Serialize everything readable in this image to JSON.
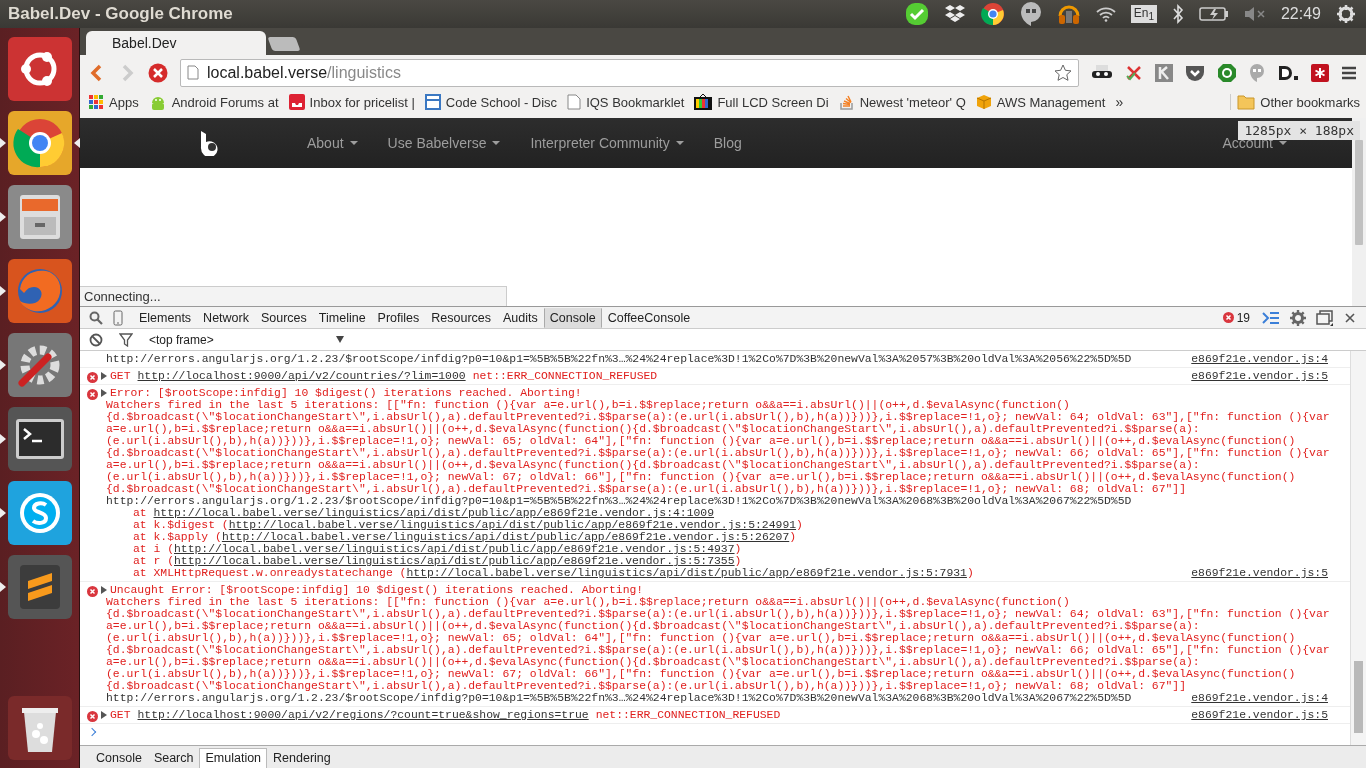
{
  "top_panel": {
    "title": "Babel.Dev - Google Chrome",
    "keyboard_layout": "En$_{1}$",
    "clock": "22:49"
  },
  "launcher": {
    "items": [
      {
        "kind": "ubuntu",
        "running": false,
        "focused": false
      },
      {
        "kind": "chrome",
        "running": true,
        "focused": true
      },
      {
        "kind": "files",
        "running": true,
        "focused": false
      },
      {
        "kind": "firefox",
        "running": true,
        "focused": false
      },
      {
        "kind": "settings",
        "running": true,
        "focused": false
      },
      {
        "kind": "terminal",
        "running": true,
        "focused": false
      },
      {
        "kind": "skype",
        "running": true,
        "focused": false
      },
      {
        "kind": "sublime",
        "running": true,
        "focused": false
      },
      {
        "kind": "trash",
        "running": false,
        "focused": false
      }
    ]
  },
  "browser": {
    "tab": {
      "title": "Babel.Dev"
    },
    "address": {
      "host": "local.babel.verse",
      "path": "/linguistics"
    },
    "bookmarks": [
      {
        "label": "Apps",
        "kind": "apps"
      },
      {
        "label": "Android Forums at",
        "kind": "robot"
      },
      {
        "label": "Inbox for pricelist |",
        "kind": "inbox"
      },
      {
        "label": "Code School - Disc",
        "kind": "window"
      },
      {
        "label": "IQS Bookmarklet",
        "kind": "page"
      },
      {
        "label": "Full LCD Screen Di",
        "kind": "tv"
      },
      {
        "label": "Newest 'meteor' Q",
        "kind": "stack"
      },
      {
        "label": "AWS Management",
        "kind": "cube"
      }
    ],
    "overflow": "»",
    "other_bookmarks": "Other bookmarks"
  },
  "page": {
    "nav": [
      {
        "label": "About",
        "caret": true
      },
      {
        "label": "Use Babelverse",
        "caret": true
      },
      {
        "label": "Interpreter Community",
        "caret": true
      },
      {
        "label": "Blog",
        "caret": false
      },
      {
        "label": "Account",
        "caret": true
      }
    ],
    "status": "Connecting...",
    "size_tooltip": "1285px × 188px"
  },
  "devtools": {
    "tabs": [
      {
        "label": "Elements",
        "selected": false
      },
      {
        "label": "Network",
        "selected": false
      },
      {
        "label": "Sources",
        "selected": false
      },
      {
        "label": "Timeline",
        "selected": false
      },
      {
        "label": "Profiles",
        "selected": false
      },
      {
        "label": "Resources",
        "selected": false
      },
      {
        "label": "Audits",
        "selected": false
      },
      {
        "label": "Console",
        "selected": true
      },
      {
        "label": "CoffeeConsole",
        "selected": false
      }
    ],
    "error_count": "19",
    "context": "<top frame>",
    "messages": [
      {
        "kind": "continuation",
        "text": "http://errors.angularjs.org/1.2.23/$rootScope/infdig?p0=10&p1=%5B%5B%22fn%3…%24%24replace%3D!1%2Co%7D%3B%20newVal%3A%2057%3B%20oldVal%3A%2056%22%5D%5D",
        "source": "e869f21e.vendor.js:4"
      },
      {
        "kind": "network",
        "method": "GET",
        "url": "http://localhost:9000/api/v2/countries/?lim=1000",
        "status": "net::ERR_CONNECTION_REFUSED",
        "source": "e869f21e.vendor.js:5"
      },
      {
        "kind": "error",
        "heading": "Error: [$rootScope:infdig] 10 $digest() iterations reached. Aborting!",
        "lines": [
          "Watchers fired in the last 5 iterations: [[\"fn: function (){var a=e.url(),b=i.$$replace;return o&&a==i.absUrl()||(o++,d.$evalAsync(function()",
          "{d.$broadcast(\\\"$locationChangeStart\\\",i.absUrl(),a).defaultPrevented?i.$$parse(a):(e.url(i.absUrl(),b),h(a))}))},i.$$replace=!1,o}; newVal: 64; oldVal: 63\"],[\"fn: function (){var",
          "a=e.url(),b=i.$$replace;return o&&a==i.absUrl()||(o++,d.$evalAsync(function(){d.$broadcast(\\\"$locationChangeStart\\\",i.absUrl(),a).defaultPrevented?i.$$parse(a):",
          "(e.url(i.absUrl(),b),h(a))}))},i.$$replace=!1,o}; newVal: 65; oldVal: 64\"],[\"fn: function (){var a=e.url(),b=i.$$replace;return o&&a==i.absUrl()||(o++,d.$evalAsync(function()",
          "{d.$broadcast(\\\"$locationChangeStart\\\",i.absUrl(),a).defaultPrevented?i.$$parse(a):(e.url(i.absUrl(),b),h(a))}))},i.$$replace=!1,o}; newVal: 66; oldVal: 65\"],[\"fn: function (){var",
          "a=e.url(),b=i.$$replace;return o&&a==i.absUrl()||(o++,d.$evalAsync(function(){d.$broadcast(\\\"$locationChangeStart\\\",i.absUrl(),a).defaultPrevented?i.$$parse(a):",
          "(e.url(i.absUrl(),b),h(a))}))},i.$$replace=!1,o}; newVal: 67; oldVal: 66\"],[\"fn: function (){var a=e.url(),b=i.$$replace;return o&&a==i.absUrl()||(o++,d.$evalAsync(function()",
          "{d.$broadcast(\\\"$locationChangeStart\\\",i.absUrl(),a).defaultPrevented?i.$$parse(a):(e.url(i.absUrl(),b),h(a))}))},i.$$replace=!1,o}; newVal: 68; oldVal: 67\"]]"
        ],
        "doc_url": "http://errors.angularjs.org/1.2.23/$rootScope/infdig?p0=10&p1=%5B%5B%22fn%3…%24%24replace%3D!1%2Co%7D%3B%20newVal%3A%2068%3B%20oldVal%3A%2067%22%5D%5D",
        "stack": [
          {
            "prefix": "at ",
            "url": "http://local.babel.verse/linguistics/api/dist/public/app/e869f21e.vendor.js:4:1009"
          },
          {
            "prefix": "at k.$digest (",
            "url": "http://local.babel.verse/linguistics/api/dist/public/app/e869f21e.vendor.js:5:24991",
            "suffix": ")"
          },
          {
            "prefix": "at k.$apply (",
            "url": "http://local.babel.verse/linguistics/api/dist/public/app/e869f21e.vendor.js:5:26207",
            "suffix": ")"
          },
          {
            "prefix": "at i (",
            "url": "http://local.babel.verse/linguistics/api/dist/public/app/e869f21e.vendor.js:5:4937",
            "suffix": ")"
          },
          {
            "prefix": "at r (",
            "url": "http://local.babel.verse/linguistics/api/dist/public/app/e869f21e.vendor.js:5:7355",
            "suffix": ")"
          },
          {
            "prefix": "at XMLHttpRequest.w.onreadystatechange (",
            "url": "http://local.babel.verse/linguistics/api/dist/public/app/e869f21e.vendor.js:5:7931",
            "suffix": ")"
          }
        ],
        "source": "e869f21e.vendor.js:5"
      },
      {
        "kind": "error",
        "heading": "Uncaught Error: [$rootScope:infdig] 10 $digest() iterations reached. Aborting!",
        "lines": [
          "Watchers fired in the last 5 iterations: [[\"fn: function (){var a=e.url(),b=i.$$replace;return o&&a==i.absUrl()||(o++,d.$evalAsync(function()",
          "{d.$broadcast(\\\"$locationChangeStart\\\",i.absUrl(),a).defaultPrevented?i.$$parse(a):(e.url(i.absUrl(),b),h(a))}))},i.$$replace=!1,o}; newVal: 64; oldVal: 63\"],[\"fn: function (){var",
          "a=e.url(),b=i.$$replace;return o&&a==i.absUrl()||(o++,d.$evalAsync(function(){d.$broadcast(\\\"$locationChangeStart\\\",i.absUrl(),a).defaultPrevented?i.$$parse(a):",
          "(e.url(i.absUrl(),b),h(a))}))},i.$$replace=!1,o}; newVal: 65; oldVal: 64\"],[\"fn: function (){var a=e.url(),b=i.$$replace;return o&&a==i.absUrl()||(o++,d.$evalAsync(function()",
          "{d.$broadcast(\\\"$locationChangeStart\\\",i.absUrl(),a).defaultPrevented?i.$$parse(a):(e.url(i.absUrl(),b),h(a))}))},i.$$replace=!1,o}; newVal: 66; oldVal: 65\"],[\"fn: function (){var",
          "a=e.url(),b=i.$$replace;return o&&a==i.absUrl()||(o++,d.$evalAsync(function(){d.$broadcast(\\\"$locationChangeStart\\\",i.absUrl(),a).defaultPrevented?i.$$parse(a):",
          "(e.url(i.absUrl(),b),h(a))}))},i.$$replace=!1,o}; newVal: 67; oldVal: 66\"],[\"fn: function (){var a=e.url(),b=i.$$replace;return o&&a==i.absUrl()||(o++,d.$evalAsync(function()",
          "{d.$broadcast(\\\"$locationChangeStart\\\",i.absUrl(),a).defaultPrevented?i.$$parse(a):(e.url(i.absUrl(),b),h(a))}))},i.$$replace=!1,o}; newVal: 68; oldVal: 67\"]]"
        ],
        "doc_url": "http://errors.angularjs.org/1.2.23/$rootScope/infdig?p0=10&p1=%5B%5B%22fn%3…%24%24replace%3D!1%2Co%7D%3B%20newVal%3A%2068%3B%20oldVal%3A%2067%22%5D%5D",
        "source": "e869f21e.vendor.js:4"
      },
      {
        "kind": "network",
        "method": "GET",
        "url": "http://localhost:9000/api/v2/regions/?count=true&show_regions=true",
        "status": "net::ERR_CONNECTION_REFUSED",
        "source": "e869f21e.vendor.js:5"
      }
    ],
    "drawer_tabs": [
      {
        "label": "Console",
        "selected": false
      },
      {
        "label": "Search",
        "selected": false
      },
      {
        "label": "Emulation",
        "selected": true
      },
      {
        "label": "Rendering",
        "selected": false
      }
    ]
  }
}
